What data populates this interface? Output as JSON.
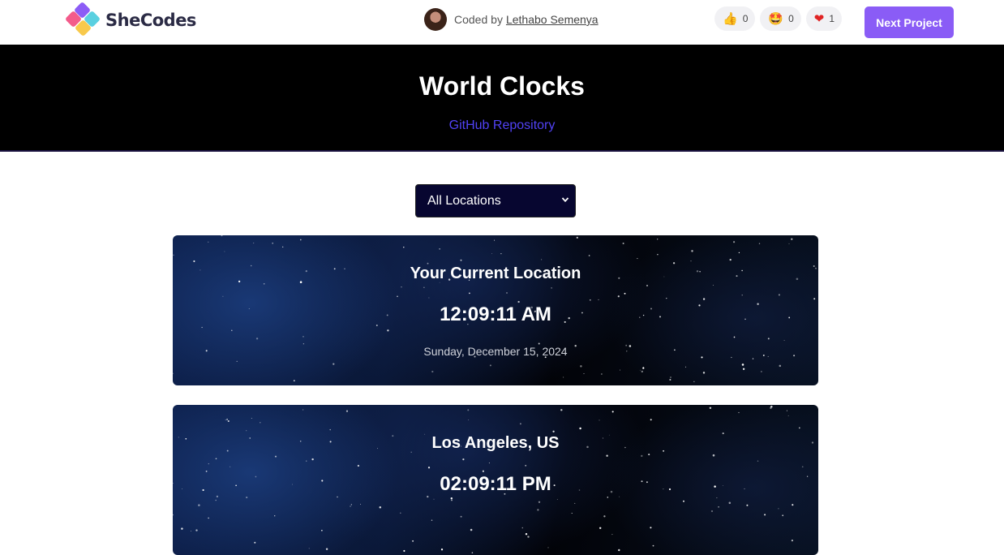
{
  "brand": {
    "name": "SheCodes"
  },
  "credit": {
    "prefix": "Coded",
    "by": "by",
    "author": "Lethabo Semenya"
  },
  "reactions": [
    {
      "icon": "thumbs-up-icon",
      "emoji": "👍",
      "count": "0"
    },
    {
      "icon": "star-eyes-icon",
      "emoji": "🤩",
      "count": "0"
    },
    {
      "icon": "heart-icon",
      "emoji": "❤",
      "count": "1"
    }
  ],
  "next_button": "Next Project",
  "header": {
    "title": "World Clocks",
    "link": "GitHub Repository"
  },
  "location_select": {
    "value": "All Locations"
  },
  "clocks": [
    {
      "city": "Your Current Location",
      "time": "12:09:11 AM",
      "date": "Sunday, December 15, 2024"
    },
    {
      "city": "Los Angeles, US",
      "time": "02:09:11 PM",
      "date": ""
    }
  ],
  "colors": {
    "accent": "#8a5cf6",
    "link": "#5142f5",
    "header_bg": "#000000",
    "select_bg": "#070630"
  }
}
